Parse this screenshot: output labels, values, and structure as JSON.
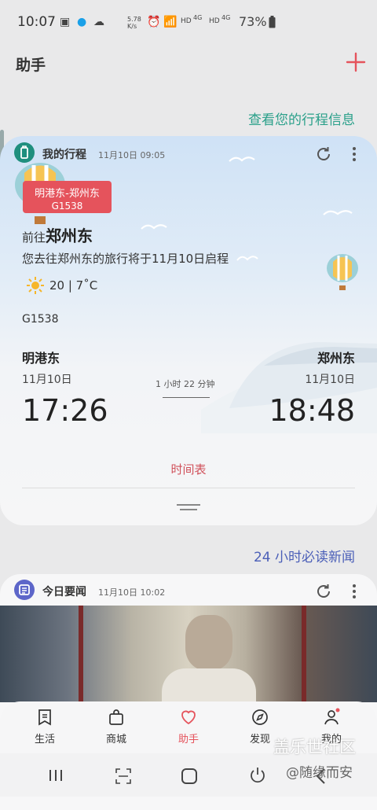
{
  "status_bar": {
    "time": "10:07",
    "net_speed_top": "5.78",
    "net_speed_bottom": "K/s",
    "hd_1": "HD",
    "net_1": "4G",
    "hd_2": "HD",
    "net_2": "4G",
    "battery": "73%"
  },
  "header": {
    "title": "助手"
  },
  "trip": {
    "section_link": "查看您的行程信息",
    "app_name": "我的行程",
    "time": "11月10日 09:05",
    "badge_route": "明港东-郑州东",
    "badge_train": "G1538",
    "to_prefix": "前往",
    "to_dest": "郑州东",
    "description": "您去往郑州东的旅行将于11月10日启程",
    "weather": "20 | 7˚C",
    "train_no": "G1538",
    "departure": {
      "station": "明港东",
      "date": "11月10日",
      "time": "17:26"
    },
    "arrival": {
      "station": "郑州东",
      "date": "11月10日",
      "time": "18:48"
    },
    "duration": "1 小时 22 分钟",
    "timetable_label": "时间表"
  },
  "news": {
    "section_link": "24 小时必读新闻",
    "app_name": "今日要闻",
    "time": "11月10日 10:02"
  },
  "bottom_nav": [
    {
      "label": "生活",
      "icon": "bookmark-icon"
    },
    {
      "label": "商城",
      "icon": "shopping-bag-icon"
    },
    {
      "label": "助手",
      "icon": "heart-icon"
    },
    {
      "label": "发现",
      "icon": "compass-icon"
    },
    {
      "label": "我的",
      "icon": "profile-icon"
    }
  ],
  "watermark": {
    "main": "盖乐世社区",
    "sub": "@随缘而安"
  },
  "colors": {
    "accent_red": "#e5535c",
    "trip_teal": "#2aa08a",
    "news_blue": "#4b5fb8"
  }
}
